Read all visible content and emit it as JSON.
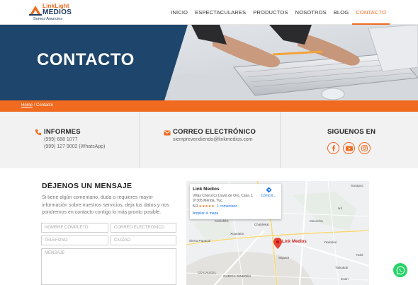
{
  "brand": {
    "name_top": "LinkLight",
    "name_bottom": "MEDIOS",
    "tagline": "Somos Anuncios",
    "colors": {
      "accent": "#f06a1f",
      "navy": "#1f3a63"
    }
  },
  "nav": {
    "items": [
      {
        "label": "INICIO"
      },
      {
        "label": "ESPECTACULARES"
      },
      {
        "label": "PRODUCTOS"
      },
      {
        "label": "NOSOTROS"
      },
      {
        "label": "BLOG"
      },
      {
        "label": "CONTACTO",
        "active": true
      }
    ]
  },
  "hero": {
    "title": "CONTACTO"
  },
  "breadcrumb": {
    "home": "Home",
    "separator": "/",
    "current": "Contacto"
  },
  "info": {
    "informes": {
      "icon": "phone-icon",
      "title": "INFORMES",
      "lines": [
        "(999) 688 1077",
        "(999) 127 9002 (WhatsApp)"
      ]
    },
    "correo": {
      "icon": "envelope-icon",
      "title": "CORREO ELECTRÓNICO",
      "lines": [
        "siemprevendiendo@linkmedios.com"
      ]
    },
    "siguenos": {
      "title": "SIGUENOS EN",
      "icons": [
        "facebook-icon",
        "youtube-icon",
        "instagram-icon"
      ]
    }
  },
  "message": {
    "title": "DÉJENOS UN MENSAJE",
    "text": "Si tiene algún comentario, duda o requieres mayor información sobre nuestros servicios, deja tus datos y nos pondremos en contacto contigo lo más pronto posible.",
    "fields": {
      "name": "NOMBRE COMPLETO",
      "email": "CORREO ELECTRONICO",
      "phone": "TELEFONO",
      "city": "CIUDAD",
      "message": "MENSAJE"
    }
  },
  "map": {
    "card": {
      "name": "Link Medios",
      "address": "Villas Chorul C/ Lluvia de Oro, Casa 1, 97305 Mérida, Yuc.",
      "rating": "5.0",
      "stars": "★★★★★",
      "reviews": "1 comentario",
      "enlarge": "Ampliar el mapa",
      "directions": "Cómo ll..."
    },
    "pin_label": "Link Medios",
    "places": {
      "sacapuc": "Sacapuc",
      "komchen": "Komchén",
      "chablekal": "Chablekal",
      "xcanatun": "Xcanatún",
      "sitpach": "Sitpach",
      "mococha": "Mococha",
      "yaxkukul": "Yaxkukul",
      "tixkokob": "Tixkokob",
      "euan": "Euan",
      "caucel": "CD CAUCEL",
      "generes": "GARCÍA GINERÉS",
      "ixil": "Ixil",
      "sierra": "Sierra Papacal",
      "nolo": "Noló"
    }
  }
}
